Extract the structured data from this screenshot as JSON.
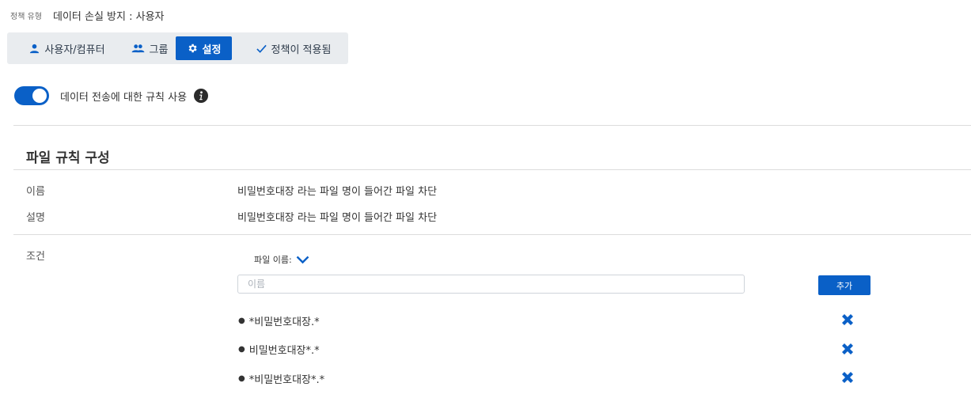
{
  "header": {
    "policy_type_label": "정책 유형",
    "policy_type_value": "데이터 손실 방지 : 사용자"
  },
  "tabs": [
    {
      "label": "사용자/컴퓨터",
      "icon": "user-icon",
      "active": false
    },
    {
      "label": "그룹",
      "icon": "group-icon",
      "active": false
    },
    {
      "label": "설정",
      "icon": "gear-icon",
      "active": true
    },
    {
      "label": "정책이 적용됨",
      "icon": "check-icon",
      "active": false
    }
  ],
  "toggle": {
    "label": "데이터 전송에 대한 규칙 사용",
    "enabled": true
  },
  "section": {
    "title": "파일 규칙 구성"
  },
  "rule": {
    "name_label": "이름",
    "name_value": "비밀번호대장 라는 파일 명이 들어간 파일 차단",
    "desc_label": "설명",
    "desc_value": "비밀번호대장 라는 파일 명이 들어간 파일 차단",
    "condition_label": "조건"
  },
  "condition": {
    "dropdown_label": "파일 이름:",
    "input_placeholder": "이름",
    "input_value": "",
    "add_label": "추가",
    "items": [
      "*비밀번호대장.*",
      "비밀번호대장*.*",
      "*비밀번호대장*.*"
    ]
  },
  "colors": {
    "accent": "#0a60c7",
    "tabbar_bg": "#e9ecef"
  }
}
